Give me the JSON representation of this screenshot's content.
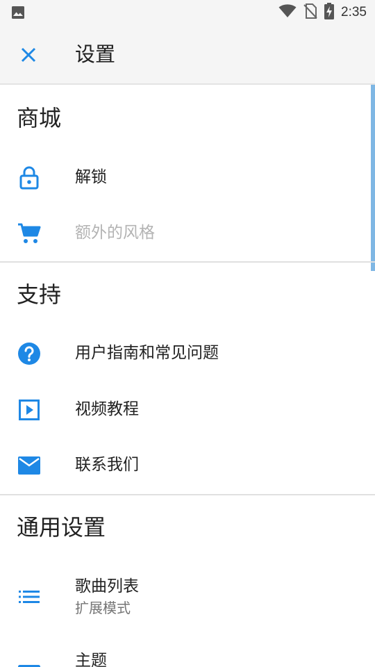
{
  "status_bar": {
    "time": "2:35"
  },
  "app_bar": {
    "title": "设置"
  },
  "sections": {
    "store": {
      "title": "商城",
      "items": [
        {
          "label": "解锁"
        },
        {
          "label": "额外的风格"
        }
      ]
    },
    "support": {
      "title": "支持",
      "items": [
        {
          "label": "用户指南和常见问题"
        },
        {
          "label": "视频教程"
        },
        {
          "label": "联系我们"
        }
      ]
    },
    "general": {
      "title": "通用设置",
      "items": [
        {
          "label": "歌曲列表",
          "sublabel": "扩展模式"
        },
        {
          "label": "主题"
        }
      ]
    }
  },
  "colors": {
    "accent": "#1e88e5",
    "disabled_text": "#b3b3b3"
  }
}
